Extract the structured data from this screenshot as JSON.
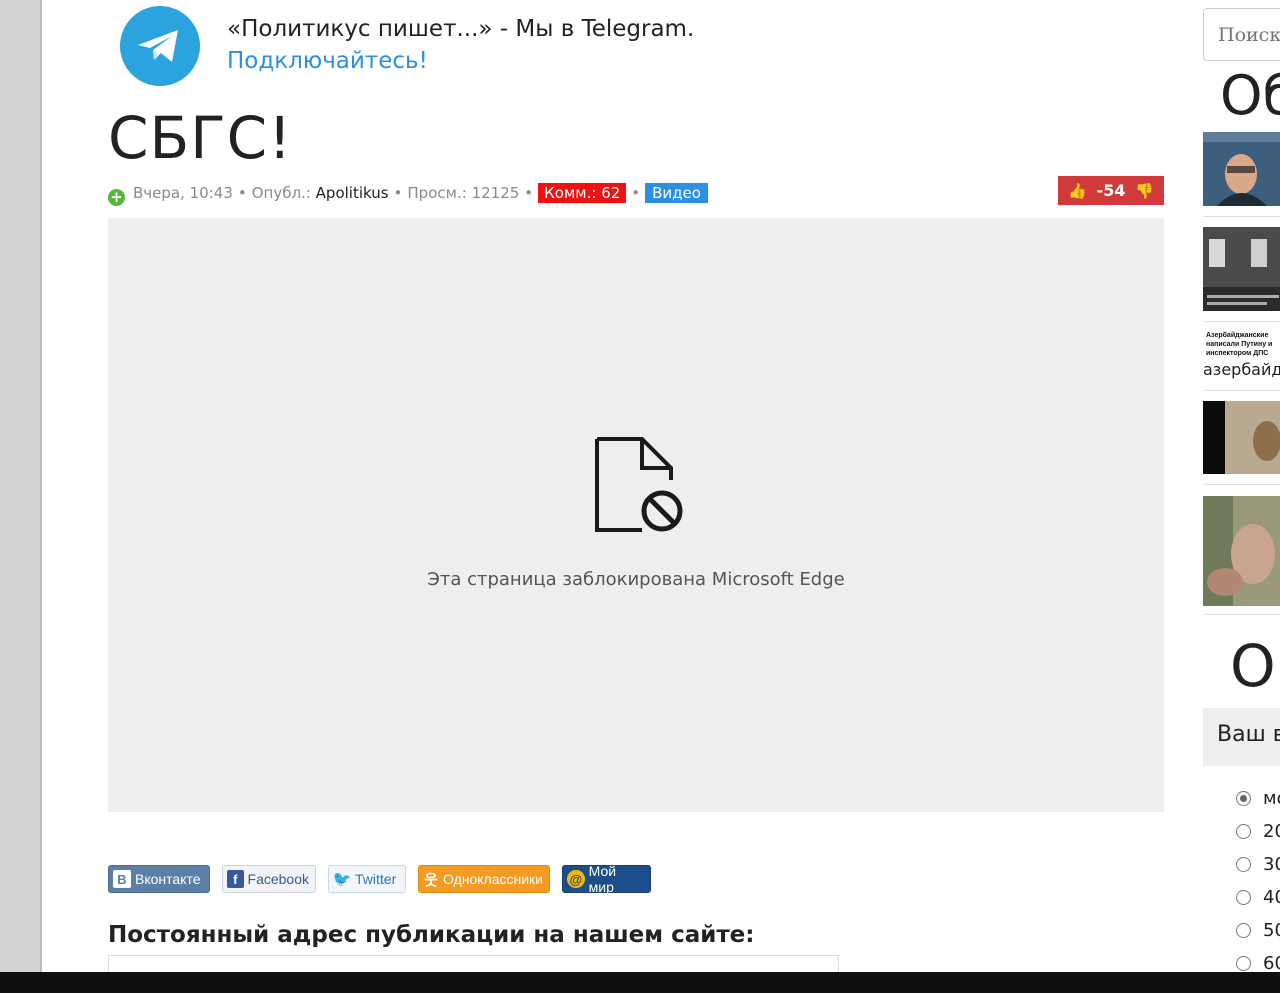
{
  "telegram": {
    "promo_text": "«Политикус пишет...» - Мы в Telegram.",
    "link_text": "Подключайтесь!"
  },
  "article": {
    "title": "СБГС!",
    "meta": {
      "date": "Вчера, 10:43",
      "published_label": "Опубл.:",
      "author": "Apolitikus",
      "views_label": "Просм.:",
      "views": "12125",
      "comments_badge": "Комм.: 62",
      "video_badge": "Видео"
    },
    "rating": "-54",
    "blocked_message": "Эта страница заблокирована Microsoft Edge",
    "permalink_title": "Постоянный адрес публикации на нашем сайте:"
  },
  "share": {
    "vk": "Вконтакте",
    "facebook": "Facebook",
    "twitter": "Twitter",
    "ok": "Одноклассники",
    "mymir": "Мой мир"
  },
  "sidebar": {
    "search_placeholder": "Поиск",
    "heading_1": "Об",
    "thumb_3_title": "Азербайджанские\nнаписали Путину и\nинспектором ДПС",
    "thumb_3_caption": "азербайд",
    "heading_2": "О",
    "poll": {
      "question": "Ваш в",
      "options": [
        "мо",
        "20",
        "30",
        "40",
        "50",
        "60"
      ]
    }
  },
  "colors": {
    "link_blue": "#2b8fe3",
    "telegram_blue": "#2aa3df",
    "comments_red": "#ee1111",
    "rating_red": "#cf3b3b",
    "blocked_bg": "#eeeeee"
  }
}
